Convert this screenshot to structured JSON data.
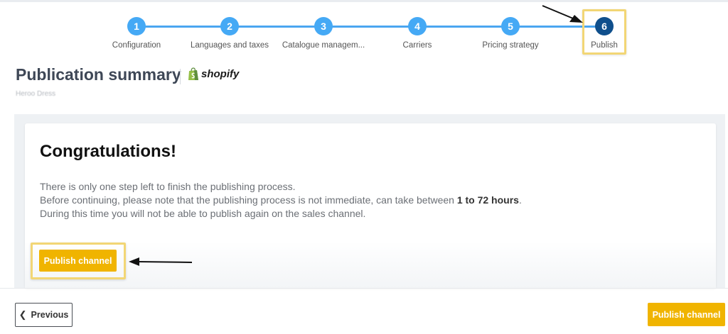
{
  "stepper": {
    "steps": [
      {
        "number": "1",
        "label": "Configuration"
      },
      {
        "number": "2",
        "label": "Languages and taxes"
      },
      {
        "number": "3",
        "label": "Catalogue managem..."
      },
      {
        "number": "4",
        "label": "Carriers"
      },
      {
        "number": "5",
        "label": "Pricing strategy"
      },
      {
        "number": "6",
        "label": "Publish"
      }
    ],
    "active_step": 6,
    "colors": {
      "done": "#45a9f5",
      "active": "#0f4f8c",
      "line": "#4aa6f0"
    }
  },
  "header": {
    "title": "Publication summary",
    "channel_logo_text": "shopify",
    "store_name": "Heroo Dress"
  },
  "card": {
    "heading": "Congratulations!",
    "line1": "There is only one step left to finish the publishing process.",
    "line2_prefix": "Before continuing, please note that the publishing process is not immediate, can take between ",
    "line2_bold": "1 to 72 hours",
    "line2_suffix": ".",
    "line3": "During this time you will not be able to publish again on the sales channel.",
    "publish_button_label": "Publish channel"
  },
  "footer": {
    "previous_label": "Previous",
    "publish_button_label": "Publish channel"
  },
  "colors": {
    "accent": "#f0b400",
    "highlight": "#f2d675",
    "title": "#3e4756"
  }
}
